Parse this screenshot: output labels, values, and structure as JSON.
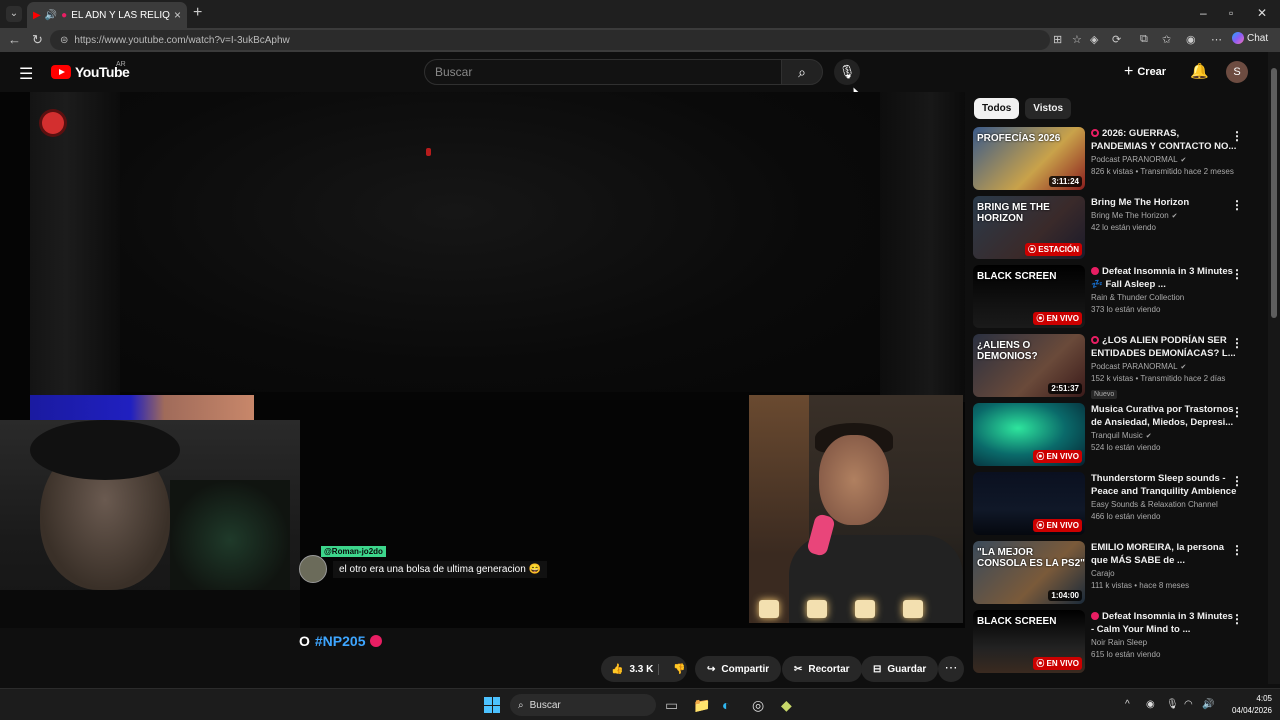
{
  "browser": {
    "tab_title": "EL ADN Y LAS RELIQUIAS",
    "url": "https://www.youtube.com/watch?v=I-3ukBcAphw",
    "chat_label": "Chat"
  },
  "header": {
    "logo_text": "YouTube",
    "country_code": "AR",
    "search_placeholder": "Buscar",
    "create_label": "Crear",
    "avatar_letter": "S"
  },
  "player": {
    "chat_user": "@Roman-jo2do",
    "chat_message": "el otro era una bolsa de ultima generacion 😄"
  },
  "video": {
    "title_visible": "O",
    "hashtag": "#NP205",
    "like_count": "3.3 K",
    "share_label": "Compartir",
    "clip_label": "Recortar",
    "save_label": "Guardar"
  },
  "sidebar": {
    "chips": [
      "Todos",
      "Vistos"
    ],
    "videos": [
      {
        "title": "2026: GUERRAS, PANDEMIAS Y CONTACTO NO...",
        "channel": "Podcast PARANORMAL",
        "verified": true,
        "meta": "826 k vistas • Transmitido hace 2 meses",
        "duration": "3:11:24",
        "thumb_text": "PROFECÍAS 2026",
        "live_dot": "ring"
      },
      {
        "title": "Bring Me The Horizon",
        "channel": "Bring Me The Horizon",
        "verified": true,
        "meta": "42 lo están viendo",
        "badge_live": "ESTACIÓN",
        "thumb_text": "BRING ME THE HORIZON"
      },
      {
        "title": "Defeat Insomnia in 3 Minutes 💤 Fall Asleep ...",
        "channel": "Rain & Thunder Collection",
        "verified": false,
        "meta": "373 lo están viendo",
        "badge_live": "EN VIVO",
        "thumb_text": "BLACK SCREEN",
        "live_dot": "solid"
      },
      {
        "title": "¿LOS ALIEN PODRÍAN SER ENTIDADES DEMONÍACAS? L...",
        "channel": "Podcast PARANORMAL",
        "verified": true,
        "meta": "152 k vistas • Transmitido hace 2 días",
        "badge": "Nuevo",
        "duration": "2:51:37",
        "thumb_text": "¿ALIENS O DEMONIOS?",
        "live_dot": "ring"
      },
      {
        "title": "Musica Curativa por Trastornos de Ansiedad, Miedos, Depresi...",
        "channel": "Tranquil Music",
        "verified": true,
        "meta": "524 lo están viendo",
        "badge_live": "EN VIVO",
        "thumb_text": ""
      },
      {
        "title": "Thunderstorm Sleep sounds - Peace and Tranquility Ambience",
        "channel": "Easy Sounds & Relaxation Channel",
        "verified": false,
        "meta": "466 lo están viendo",
        "badge_live": "EN VIVO",
        "thumb_text": ""
      },
      {
        "title": "EMILIO MOREIRA, la persona que MÁS SABE de ...",
        "channel": "Carajo",
        "verified": false,
        "meta": "111 k vistas • hace 8 meses",
        "duration": "1:04:00",
        "thumb_text": "\"LA MEJOR CONSOLA ES LA PS2\""
      },
      {
        "title": "Defeat Insomnia in 3 Minutes - Calm Your Mind to ...",
        "channel": "Noir Rain Sleep",
        "verified": false,
        "meta": "615 lo están viendo",
        "badge_live": "EN VIVO",
        "thumb_text": "BLACK SCREEN",
        "live_dot": "solid"
      }
    ]
  },
  "taskbar": {
    "search_label": "Buscar",
    "time": "4:05",
    "date": "04/04/2026"
  },
  "colors": {
    "background": "#0f0f0f",
    "youtube_red": "#ff0000",
    "live_red": "#cc0000",
    "link_blue": "#3ea6ff",
    "chat_user_green": "#3dd68c"
  }
}
